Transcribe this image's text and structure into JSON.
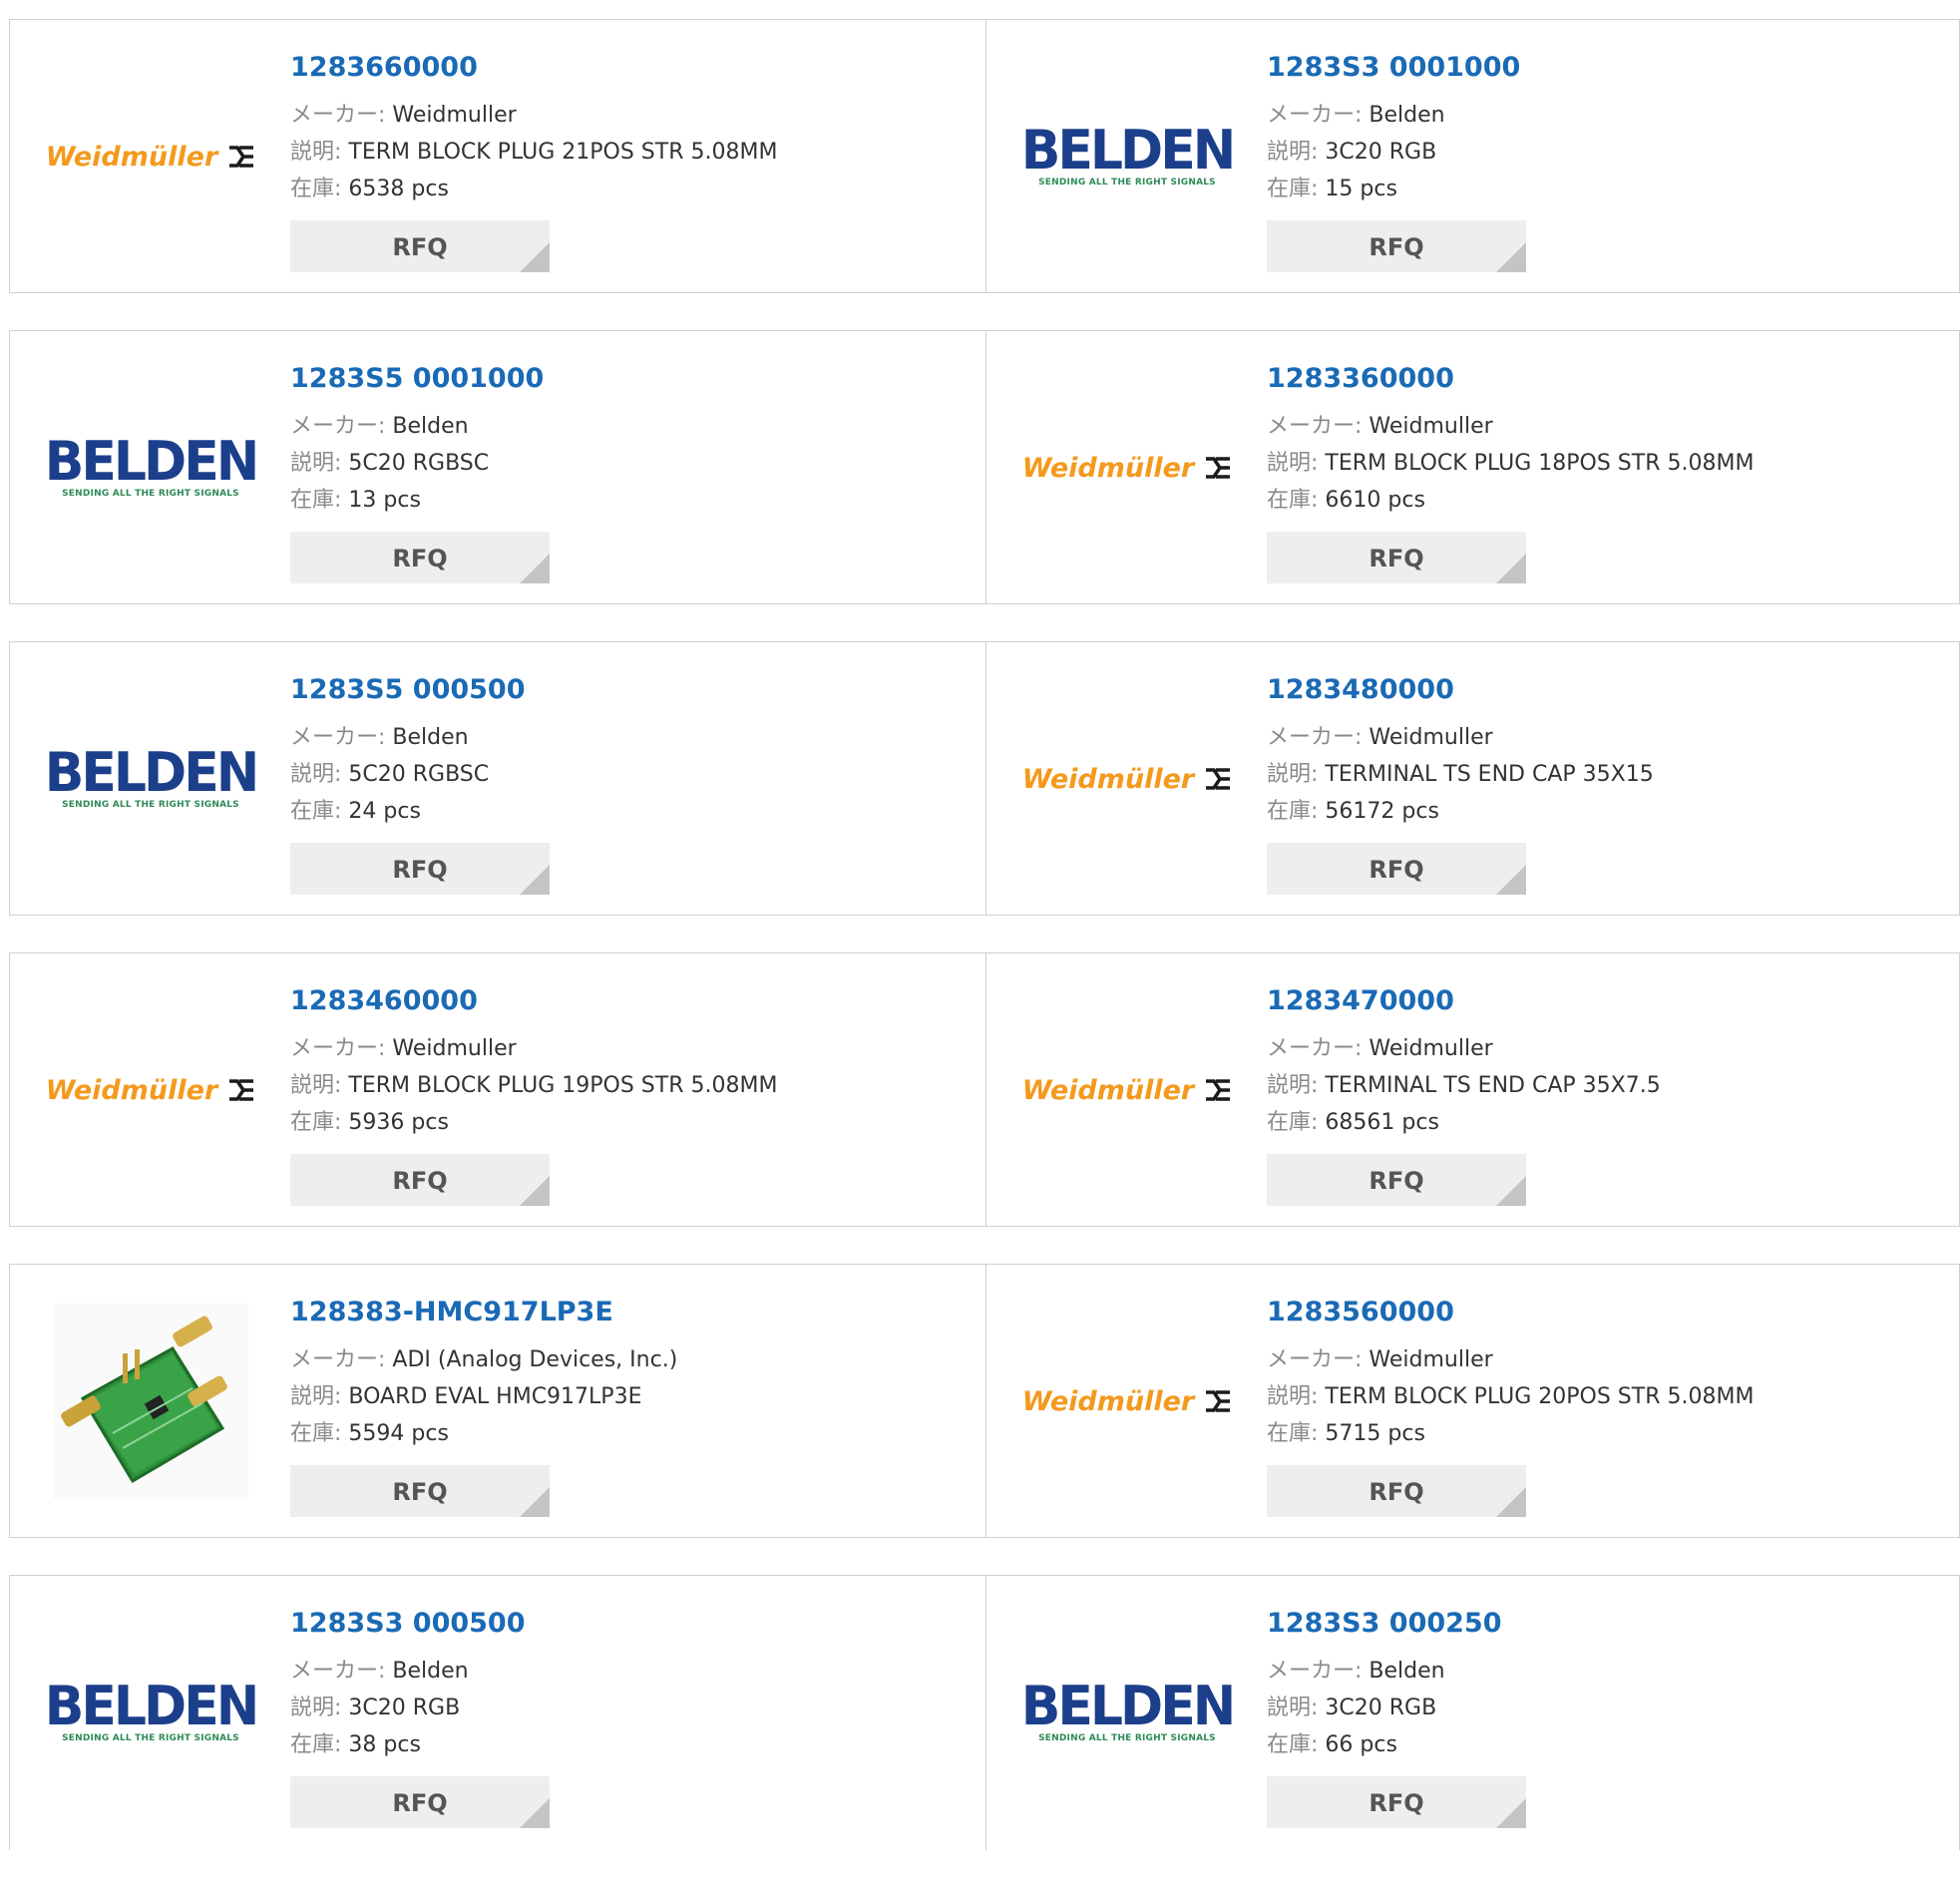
{
  "labels": {
    "maker": "メーカー:",
    "desc": "説明:",
    "stock": "在庫:",
    "rfq": "RFQ"
  },
  "logos": {
    "weidmuller_text": "Weidmüller",
    "belden_text": "BELDEN",
    "belden_tagline": "SENDING ALL THE RIGHT SIGNALS"
  },
  "products": [
    {
      "part": "1283660000",
      "maker": "Weidmuller",
      "desc": "TERM BLOCK PLUG 21POS STR 5.08MM",
      "stock": "6538 pcs",
      "logo": "weidmuller-logo"
    },
    {
      "part": "1283S3 0001000",
      "maker": "Belden",
      "desc": "3C20 RGB",
      "stock": "15 pcs",
      "logo": "belden-logo"
    },
    {
      "part": "1283S5 0001000",
      "maker": "Belden",
      "desc": "5C20 RGBSC",
      "stock": "13 pcs",
      "logo": "belden-logo"
    },
    {
      "part": "1283360000",
      "maker": "Weidmuller",
      "desc": "TERM BLOCK PLUG 18POS STR 5.08MM",
      "stock": "6610 pcs",
      "logo": "weidmuller-logo"
    },
    {
      "part": "1283S5 000500",
      "maker": "Belden",
      "desc": "5C20 RGBSC",
      "stock": "24 pcs",
      "logo": "belden-logo"
    },
    {
      "part": "1283480000",
      "maker": "Weidmuller",
      "desc": "TERMINAL TS END CAP 35X15",
      "stock": "56172 pcs",
      "logo": "weidmuller-logo"
    },
    {
      "part": "1283460000",
      "maker": "Weidmuller",
      "desc": "TERM BLOCK PLUG 19POS STR 5.08MM",
      "stock": "5936 pcs",
      "logo": "weidmuller-logo"
    },
    {
      "part": "1283470000",
      "maker": "Weidmuller",
      "desc": "TERMINAL TS END CAP 35X7.5",
      "stock": "68561 pcs",
      "logo": "weidmuller-logo"
    },
    {
      "part": "128383-HMC917LP3E",
      "maker": "ADI (Analog Devices, Inc.)",
      "desc": "BOARD EVAL HMC917LP3E",
      "stock": "5594 pcs",
      "logo": "board-photo"
    },
    {
      "part": "1283560000",
      "maker": "Weidmuller",
      "desc": "TERM BLOCK PLUG 20POS STR 5.08MM",
      "stock": "5715 pcs",
      "logo": "weidmuller-logo"
    },
    {
      "part": "1283S3 000500",
      "maker": "Belden",
      "desc": "3C20 RGB",
      "stock": "38 pcs",
      "logo": "belden-logo"
    },
    {
      "part": "1283S3 000250",
      "maker": "Belden",
      "desc": "3C20 RGB",
      "stock": "66 pcs",
      "logo": "belden-logo"
    }
  ],
  "colors": {
    "part_link": "#1a6ab5",
    "label_gray": "#8a8a8a",
    "weidmuller_orange": "#f39a1e",
    "belden_blue": "#1c3f8c",
    "belden_green": "#2e8b57",
    "rfq_bg": "#eeeeee"
  }
}
